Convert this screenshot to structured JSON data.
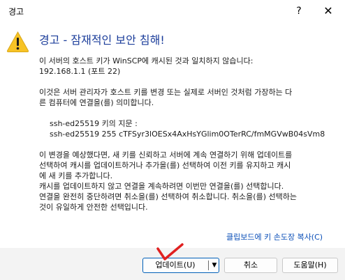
{
  "window": {
    "title": "경고",
    "help_label": "?",
    "close_label": "✕"
  },
  "dialog": {
    "heading": "경고 - 잠재적인 보안 침해!",
    "para1_line1": "이 서버의 호스트 키가 WinSCP에 캐시된 것과 일치하지 않습니다:",
    "para1_line2": "192.168.1.1 (포트 22)",
    "para2_line1": "이것은 서버 관리자가 호스트 키를 변경 또는 실제로 서버인 것처럼 가장하는 다",
    "para2_line2": "른 컴퓨터에 연결을(를) 의미합니다.",
    "fingerprint_label": "ssh-ed25519 키의 지문 :",
    "fingerprint_value": "ssh-ed25519 255 cTFSyr3lOESx4AxHsYGlim0OTerRC/fmMGVwB04sVm8",
    "para3_line1": "이 변경을 예상했다면, 새 키를 신뢰하고 서버에 계속 연결하기 위해 업데이트를",
    "para3_line2": "선택하여 캐시를 업데이트하거나 추가을(를) 선택하여 이전 키를 유지하고 캐시",
    "para3_line3": "에 새 키를 추가합니다.",
    "para3_line4": "캐시를 업데이트하지 않고 연결을 계속하려면 이번만 연결을(를) 선택합니다.",
    "para3_line5": "연결을 완전히 중단하려면 취소을(를) 선택하여 취소합니다. 취소을(를) 선택하는",
    "para3_line6": "것이 유일하게 안전한 선택입니다.",
    "clipboard_link": "클립보드에 키 손도장 복사(C)"
  },
  "buttons": {
    "update": "업데이트(U)",
    "update_dropdown": "▼",
    "cancel": "취소",
    "help": "도움말(H)"
  },
  "colors": {
    "heading": "#1a3c9a",
    "link": "#0b4fb8",
    "primary_border": "#005fb8",
    "footer_bg": "#f3f3f3",
    "checkmark": "#e02020"
  }
}
